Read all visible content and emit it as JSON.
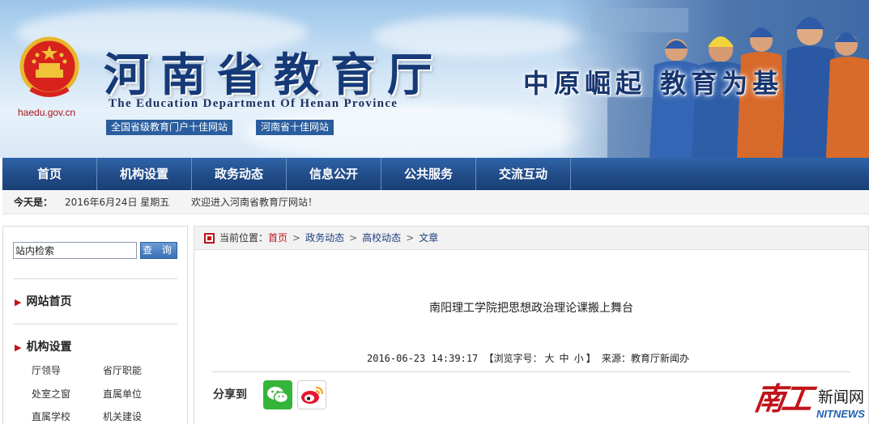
{
  "header": {
    "domain": "haedu.gov.cn",
    "title": "河南省教育厅",
    "title_en": "The Education Department Of Henan Province",
    "awards": [
      "全国省级教育门户十佳网站",
      "河南省十佳网站"
    ],
    "slogan": "中原崛起  教育为基"
  },
  "nav": {
    "items": [
      {
        "label": "首页"
      },
      {
        "label": "机构设置"
      },
      {
        "label": "政务动态"
      },
      {
        "label": "信息公开"
      },
      {
        "label": "公共服务"
      },
      {
        "label": "交流互动"
      }
    ]
  },
  "datebar": {
    "label": "今天是：",
    "date": "2016年6月24日 星期五",
    "welcome": "欢迎进入河南省教育厅网站！"
  },
  "sidebar": {
    "search": {
      "value": "站内检索",
      "button_label": "查 询"
    },
    "sections": [
      {
        "title": "网站首页"
      },
      {
        "title": "机构设置",
        "links": [
          "厅领导",
          "省厅职能",
          "处室之窗",
          "直属单位",
          "直属学校",
          "机关建设"
        ]
      }
    ]
  },
  "breadcrumb": {
    "label": "当前位置：",
    "items": [
      "首页",
      "政务动态",
      "高校动态",
      "文章"
    ],
    "separator": ">"
  },
  "article": {
    "title": "南阳理工学院把思想政治理论课搬上舞台",
    "datetime": "2016-06-23 14:39:17",
    "font_size_open": "【浏览字号：",
    "font_sizes": [
      "大",
      "中",
      "小"
    ],
    "font_size_close": "】",
    "source": "来源：教育厅新闻办"
  },
  "share": {
    "label": "分享到"
  },
  "watermark": {
    "chinese": "南工",
    "news": "新闻网",
    "english": "NITNEWS"
  },
  "colors": {
    "nav": "#214c88",
    "accent_red": "#c0141b",
    "link": "#1d3f7e",
    "wechat": "#35b43a"
  }
}
